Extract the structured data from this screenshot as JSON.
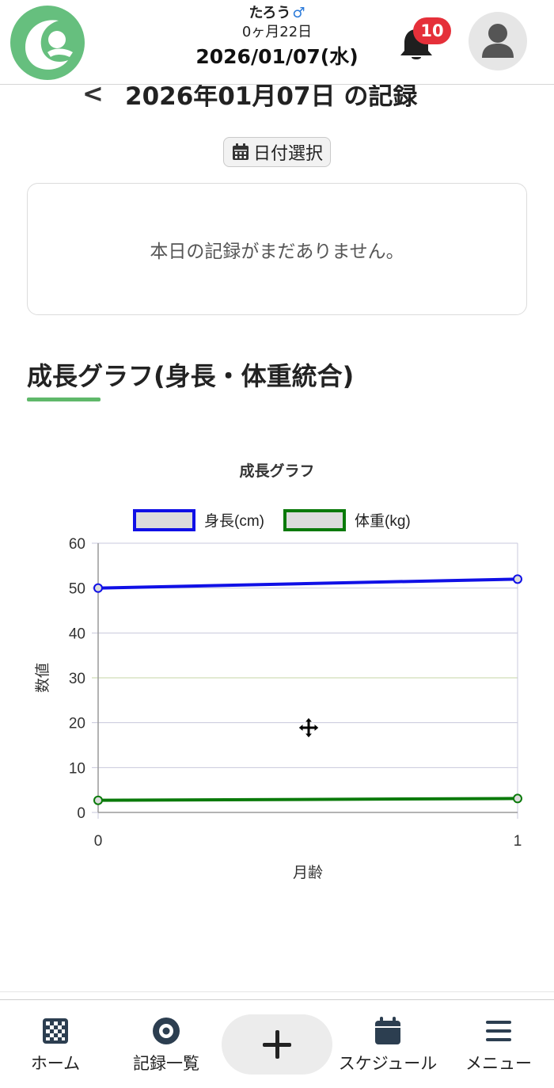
{
  "header": {
    "child_name": "たろう",
    "gender_symbol": "♂",
    "age": "0ヶ月22日",
    "date": "2026/01/07(水)",
    "notification_count": "10",
    "colors": {
      "logo": "#66bf7e",
      "badge": "#e5303a"
    }
  },
  "record": {
    "back_icon": "chevron-left-icon",
    "title": "2026年01月07日 の記録",
    "date_button_label": "日付選択",
    "empty_message": "本日の記録がまだありません。"
  },
  "growth": {
    "section_title": "成長グラフ(身長・体重統合)"
  },
  "chart_data": {
    "type": "line",
    "title": "成長グラフ",
    "xlabel": "月齢",
    "ylabel": "数値",
    "x": [
      0,
      1
    ],
    "ylim": [
      0,
      60
    ],
    "yticks": [
      "0",
      "10",
      "20",
      "30",
      "40",
      "50",
      "60"
    ],
    "xticks": [
      "0",
      "1"
    ],
    "grid": true,
    "legend_position": "top",
    "series": [
      {
        "name": "身長(cm)",
        "values": [
          50,
          52
        ],
        "color": "#1010e6"
      },
      {
        "name": "体重(kg)",
        "values": [
          2.7,
          3.1
        ],
        "color": "#0a7a0a"
      }
    ]
  },
  "nav": {
    "items": [
      {
        "label": "ホーム",
        "icon": "home-grid-icon"
      },
      {
        "label": "記録一覧",
        "icon": "record-list-icon"
      },
      {
        "label": "",
        "icon": "plus-icon"
      },
      {
        "label": "スケジュール",
        "icon": "calendar-icon"
      },
      {
        "label": "メニュー",
        "icon": "menu-icon"
      }
    ]
  }
}
